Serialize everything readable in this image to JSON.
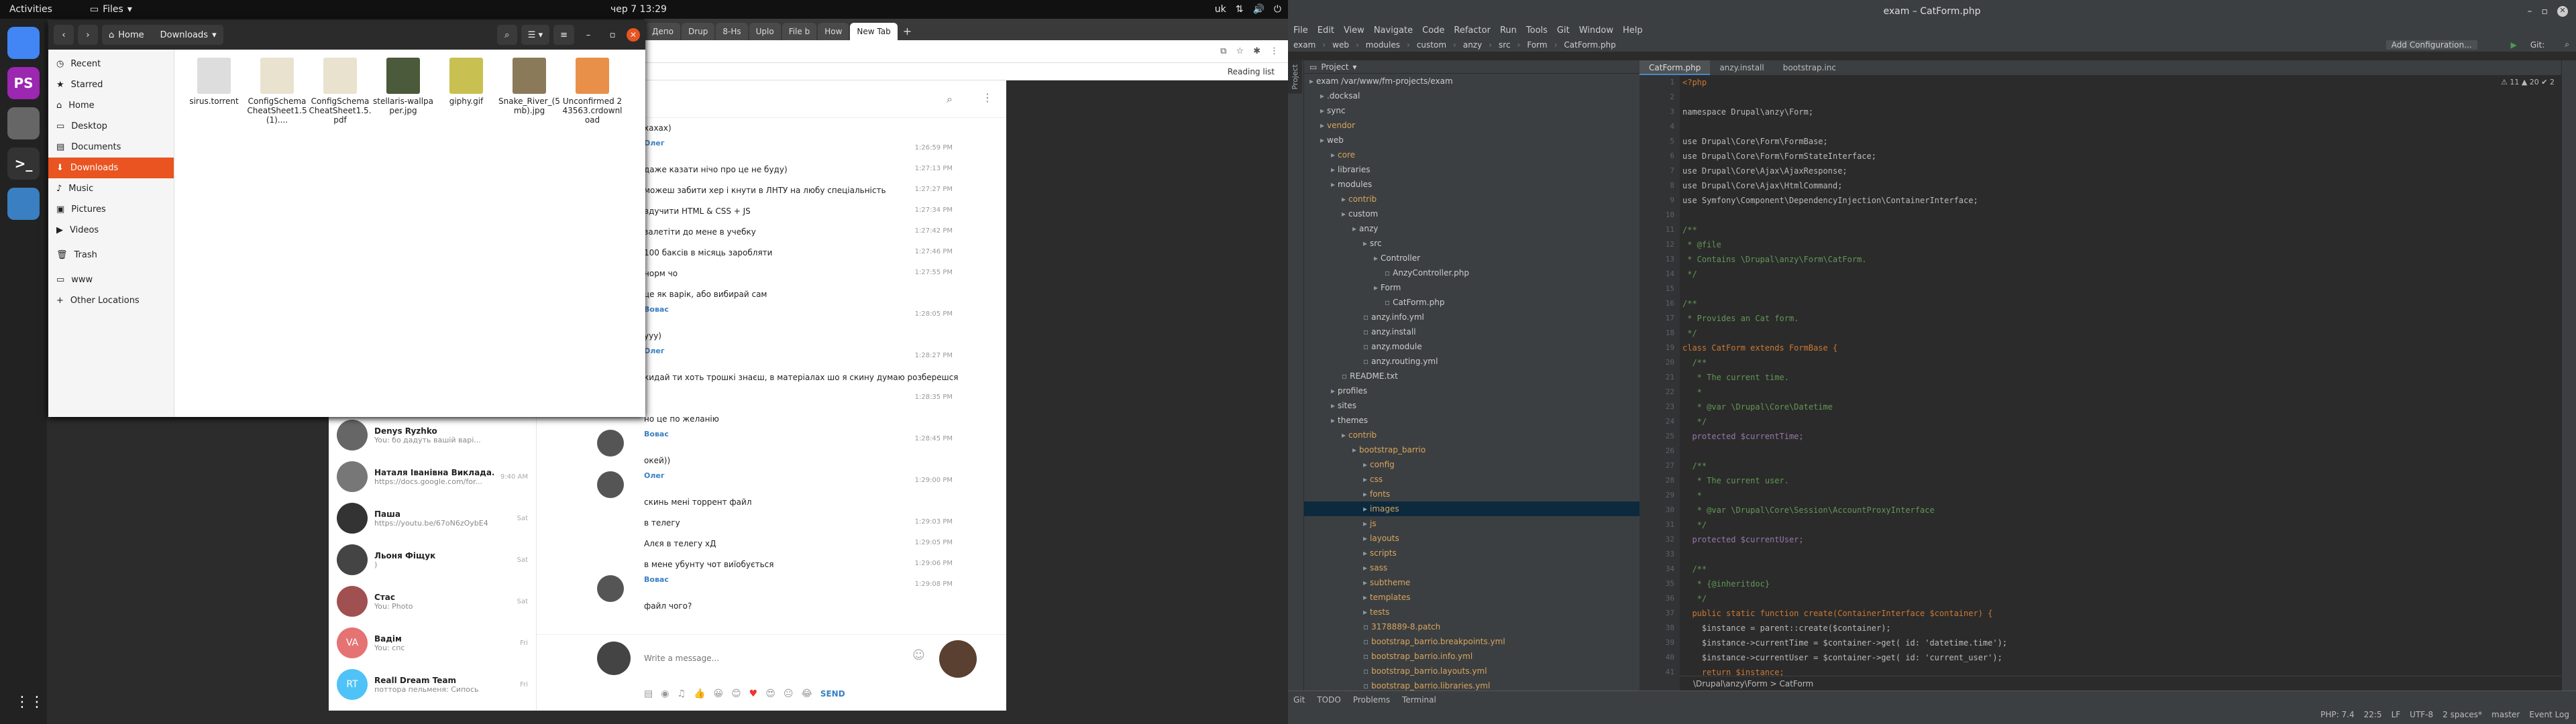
{
  "topbar": {
    "activities": "Activities",
    "app": "Files",
    "clock": "чер 7  13:29",
    "lang": "uk"
  },
  "dock": [
    {
      "name": "chrome-icon",
      "color": "#4285f4",
      "label": ""
    },
    {
      "name": "phpstorm-icon",
      "color": "#9c27b0",
      "label": "PS"
    },
    {
      "name": "files-icon",
      "color": "#666",
      "label": ""
    },
    {
      "name": "terminal-icon",
      "color": "#333",
      "label": ">_"
    },
    {
      "name": "screenshot-icon",
      "color": "#3a7fc1",
      "label": ""
    }
  ],
  "files": {
    "title": "Downloads",
    "home": "Home",
    "sidebar": [
      {
        "label": "Recent",
        "icon": "◷"
      },
      {
        "label": "Starred",
        "icon": "★"
      },
      {
        "label": "Home",
        "icon": "⌂"
      },
      {
        "label": "Desktop",
        "icon": "▭"
      },
      {
        "label": "Documents",
        "icon": "▤"
      },
      {
        "label": "Downloads",
        "icon": "⬇",
        "selected": true
      },
      {
        "label": "Music",
        "icon": "♪"
      },
      {
        "label": "Pictures",
        "icon": "▣"
      },
      {
        "label": "Videos",
        "icon": "▶"
      },
      {
        "label": "Trash",
        "icon": "🗑"
      },
      {
        "label": "www",
        "icon": "▭"
      },
      {
        "label": "Other Locations",
        "icon": "+"
      }
    ],
    "items": [
      {
        "label": "sirus.torrent",
        "color": "#ddd"
      },
      {
        "label": "ConfigSchemaCheatSheet1.5 (1)....",
        "color": "#e9e2cf"
      },
      {
        "label": "ConfigSchemaCheatSheet1.5.pdf",
        "color": "#e9e2cf"
      },
      {
        "label": "stellaris-wallpaper.jpg",
        "color": "#4a5a3a"
      },
      {
        "label": "giphy.gif",
        "color": "#c8c050"
      },
      {
        "label": "Snake_River_(5mb).jpg",
        "color": "#8a7a5a"
      },
      {
        "label": "Unconfirmed 243563.crdownload",
        "color": "#e8904a"
      }
    ]
  },
  "telegram": {
    "chats": [
      {
        "name": "Denys Ryzhko",
        "preview": "You: бо дадуть вашій варі...",
        "time": "",
        "color": "#666"
      },
      {
        "name": "Наталя Іванівна Виклада...",
        "preview": "https://docs.google.com/for...",
        "time": "9:40 AM",
        "color": "#777"
      },
      {
        "name": "Паша",
        "preview": "https://youtu.be/67oN6zOybE4",
        "time": "Sat",
        "color": "#333"
      },
      {
        "name": "Льоня Фіщук",
        "preview": ")",
        "time": "Sat",
        "color": "#444"
      },
      {
        "name": "Стас",
        "preview": "You: Photo",
        "time": "Sat",
        "color": "#a05050"
      },
      {
        "name": "Вадім",
        "preview": "You: спс",
        "time": "Fri",
        "color": "#e57373",
        "initials": "VA"
      },
      {
        "name": "Reall Dream Team",
        "preview": "поттора пельменя: Сипось",
        "time": "Fri",
        "color": "#4fc3f7",
        "initials": "RT"
      }
    ],
    "messages": [
      {
        "sender": "",
        "text": "хахах)",
        "time": ""
      },
      {
        "sender": "Олег",
        "text": "",
        "time": "1:26:59 PM"
      },
      {
        "sender": "",
        "text": "даже казати нічо про це не буду)",
        "time": "1:27:13 PM"
      },
      {
        "sender": "",
        "text": "можеш забити хер і кнути в ЛНТУ на любу спеціальність",
        "time": "1:27:27 PM"
      },
      {
        "sender": "",
        "text": "вдучити HTML & CSS + JS",
        "time": "1:27:34 PM"
      },
      {
        "sender": "",
        "text": "залетіти до мене в учебку",
        "time": "1:27:42 PM"
      },
      {
        "sender": "",
        "text": "100 баксів в місяць заробляти",
        "time": "1:27:46 PM"
      },
      {
        "sender": "",
        "text": "норм чо",
        "time": "1:27:55 PM"
      },
      {
        "sender": "",
        "text": "це як варік, або вибирай сам",
        "time": ""
      },
      {
        "sender": "Вовас",
        "text": "",
        "time": "1:28:05 PM"
      },
      {
        "sender": "",
        "text": "ууу)",
        "time": ""
      },
      {
        "sender": "Олег",
        "text": "",
        "time": "1:28:27 PM"
      },
      {
        "sender": "",
        "text": "кидай ти хоть трошкі знаєш, в матеріалах шо я скину думаю розберешся",
        "time": ""
      },
      {
        "sender": "",
        "text": "",
        "time": "1:28:35 PM"
      },
      {
        "sender": "",
        "text": "но це по желанію",
        "time": ""
      },
      {
        "sender": "Вовас",
        "text": "",
        "time": "1:28:45 PM"
      },
      {
        "sender": "",
        "text": "окей))",
        "time": ""
      },
      {
        "sender": "Олег",
        "text": "",
        "time": "1:29:00 PM"
      },
      {
        "sender": "",
        "text": "скинь мені торрент файл",
        "time": ""
      },
      {
        "sender": "",
        "text": "в телегу",
        "time": "1:29:03 PM"
      },
      {
        "sender": "",
        "text": "Алєя в телегу хД",
        "time": "1:29:05 PM"
      },
      {
        "sender": "",
        "text": "в мене убунту чот виїобується",
        "time": "1:29:06 PM"
      },
      {
        "sender": "Вовас",
        "text": "",
        "time": "1:29:08 PM"
      },
      {
        "sender": "",
        "text": "файл чого?",
        "time": ""
      }
    ],
    "input_placeholder": "Write a message...",
    "send": "SEND"
  },
  "chrome": {
    "tabs": [
      "Депо",
      "Drup",
      "8-Hs",
      "Uplo",
      "File b",
      "How",
      "New Tab"
    ],
    "reading_list": "Reading list"
  },
  "ide": {
    "title": "exam – CatForm.php",
    "menu": [
      "File",
      "Edit",
      "View",
      "Navigate",
      "Code",
      "Refactor",
      "Run",
      "Tools",
      "Git",
      "Window",
      "Help"
    ],
    "breadcrumb": [
      "exam",
      "web",
      "modules",
      "custom",
      "anzy",
      "src",
      "Form",
      "CatForm.php"
    ],
    "add_config": "Add Configuration...",
    "git": "Git:",
    "project_label": "Project",
    "tree": [
      {
        "d": 0,
        "t": "exam /var/www/fm-projects/exam",
        "c": "#ccc"
      },
      {
        "d": 1,
        "t": ".docksal",
        "c": "#ccc"
      },
      {
        "d": 1,
        "t": "sync",
        "c": "#ccc"
      },
      {
        "d": 1,
        "t": "vendor",
        "c": "#d8a55f"
      },
      {
        "d": 1,
        "t": "web",
        "c": "#ccc"
      },
      {
        "d": 2,
        "t": "core",
        "c": "#d8a55f"
      },
      {
        "d": 2,
        "t": "libraries",
        "c": "#ccc"
      },
      {
        "d": 2,
        "t": "modules",
        "c": "#ccc"
      },
      {
        "d": 3,
        "t": "contrib",
        "c": "#d8a55f"
      },
      {
        "d": 3,
        "t": "custom",
        "c": "#ccc"
      },
      {
        "d": 4,
        "t": "anzy",
        "c": "#ccc"
      },
      {
        "d": 5,
        "t": "src",
        "c": "#ccc"
      },
      {
        "d": 6,
        "t": "Controller",
        "c": "#ccc"
      },
      {
        "d": 7,
        "t": "AnzyController.php",
        "c": "#ccc"
      },
      {
        "d": 6,
        "t": "Form",
        "c": "#ccc"
      },
      {
        "d": 7,
        "t": "CatForm.php",
        "c": "#ccc"
      },
      {
        "d": 5,
        "t": "anzy.info.yml",
        "c": "#ccc"
      },
      {
        "d": 5,
        "t": "anzy.install",
        "c": "#ccc"
      },
      {
        "d": 5,
        "t": "anzy.module",
        "c": "#ccc"
      },
      {
        "d": 5,
        "t": "anzy.routing.yml",
        "c": "#ccc"
      },
      {
        "d": 3,
        "t": "README.txt",
        "c": "#ccc"
      },
      {
        "d": 2,
        "t": "profiles",
        "c": "#ccc"
      },
      {
        "d": 2,
        "t": "sites",
        "c": "#ccc"
      },
      {
        "d": 2,
        "t": "themes",
        "c": "#ccc"
      },
      {
        "d": 3,
        "t": "contrib",
        "c": "#d8a55f"
      },
      {
        "d": 4,
        "t": "bootstrap_barrio",
        "c": "#d8a55f"
      },
      {
        "d": 5,
        "t": "config",
        "c": "#d8a55f"
      },
      {
        "d": 5,
        "t": "css",
        "c": "#d8a55f"
      },
      {
        "d": 5,
        "t": "fonts",
        "c": "#d8a55f"
      },
      {
        "d": 5,
        "t": "images",
        "c": "#d8a55f",
        "sel": true
      },
      {
        "d": 5,
        "t": "js",
        "c": "#d8a55f"
      },
      {
        "d": 5,
        "t": "layouts",
        "c": "#d8a55f"
      },
      {
        "d": 5,
        "t": "scripts",
        "c": "#d8a55f"
      },
      {
        "d": 5,
        "t": "sass",
        "c": "#d8a55f"
      },
      {
        "d": 5,
        "t": "subtheme",
        "c": "#d8a55f"
      },
      {
        "d": 5,
        "t": "templates",
        "c": "#d8a55f"
      },
      {
        "d": 5,
        "t": "tests",
        "c": "#d8a55f"
      },
      {
        "d": 5,
        "t": "3178889-8.patch",
        "c": "#d8a55f"
      },
      {
        "d": 5,
        "t": "bootstrap_barrio.breakpoints.yml",
        "c": "#d8a55f"
      },
      {
        "d": 5,
        "t": "bootstrap_barrio.info.yml",
        "c": "#d8a55f"
      },
      {
        "d": 5,
        "t": "bootstrap_barrio.layouts.yml",
        "c": "#d8a55f"
      },
      {
        "d": 5,
        "t": "bootstrap_barrio.libraries.yml",
        "c": "#d8a55f"
      }
    ],
    "tabs": [
      {
        "t": "CatForm.php",
        "on": true
      },
      {
        "t": "anzy.install",
        "on": false
      },
      {
        "t": "bootstrap.inc",
        "on": false
      }
    ],
    "code": [
      {
        "t": "<?php",
        "c": "#cc7832"
      },
      {
        "t": "",
        "c": "#bbb"
      },
      {
        "t": "namespace Drupal\\anzy\\Form;",
        "c": "#bbb"
      },
      {
        "t": "",
        "c": "#bbb"
      },
      {
        "t": "use Drupal\\Core\\Form\\FormBase;",
        "c": "#bbb"
      },
      {
        "t": "use Drupal\\Core\\Form\\FormStateInterface;",
        "c": "#bbb"
      },
      {
        "t": "use Drupal\\Core\\Ajax\\AjaxResponse;",
        "c": "#bbb"
      },
      {
        "t": "use Drupal\\Core\\Ajax\\HtmlCommand;",
        "c": "#bbb"
      },
      {
        "t": "use Symfony\\Component\\DependencyInjection\\ContainerInterface;",
        "c": "#bbb"
      },
      {
        "t": "",
        "c": "#bbb"
      },
      {
        "t": "/**",
        "c": "#629755"
      },
      {
        "t": " * @file",
        "c": "#629755"
      },
      {
        "t": " * Contains \\Drupal\\anzy\\Form\\CatForm.",
        "c": "#629755"
      },
      {
        "t": " */",
        "c": "#629755"
      },
      {
        "t": "",
        "c": "#bbb"
      },
      {
        "t": "/**",
        "c": "#629755"
      },
      {
        "t": " * Provides an Cat form.",
        "c": "#629755"
      },
      {
        "t": " */",
        "c": "#629755"
      },
      {
        "t": "class CatForm extends FormBase {",
        "c": "#cc7832"
      },
      {
        "t": "  /**",
        "c": "#629755"
      },
      {
        "t": "   * The current time.",
        "c": "#629755"
      },
      {
        "t": "   *",
        "c": "#629755"
      },
      {
        "t": "   * @var \\Drupal\\Core\\Datetime",
        "c": "#629755"
      },
      {
        "t": "   */",
        "c": "#629755"
      },
      {
        "t": "  protected $currentTime;",
        "c": "#9876aa"
      },
      {
        "t": "",
        "c": "#bbb"
      },
      {
        "t": "  /**",
        "c": "#629755"
      },
      {
        "t": "   * The current user.",
        "c": "#629755"
      },
      {
        "t": "   *",
        "c": "#629755"
      },
      {
        "t": "   * @var \\Drupal\\Core\\Session\\AccountProxyInterface",
        "c": "#629755"
      },
      {
        "t": "   */",
        "c": "#629755"
      },
      {
        "t": "  protected $currentUser;",
        "c": "#9876aa"
      },
      {
        "t": "",
        "c": "#bbb"
      },
      {
        "t": "  /**",
        "c": "#629755"
      },
      {
        "t": "   * {@inheritdoc}",
        "c": "#629755"
      },
      {
        "t": "   */",
        "c": "#629755"
      },
      {
        "t": "  public static function create(ContainerInterface $container) {",
        "c": "#cc7832"
      },
      {
        "t": "    $instance = parent::create($container);",
        "c": "#bbb"
      },
      {
        "t": "    $instance->currentTime = $container->get( id: 'datetime.time');",
        "c": "#bbb"
      },
      {
        "t": "    $instance->currentUser = $container->get( id: 'current_user');",
        "c": "#bbb"
      },
      {
        "t": "    return $instance;",
        "c": "#cc7832"
      }
    ],
    "crumb_bottom": "\\Drupal\\anzy\\Form  >  CatForm",
    "warnings": "⚠ 11  ▲ 20  ✔ 2",
    "bottom_tabs": [
      "Git",
      "TODO",
      "Problems",
      "Terminal"
    ],
    "status": [
      "PHP: 7.4",
      "22:5",
      "LF",
      "UTF-8",
      "2 spaces*",
      "master"
    ],
    "event_log": "Event Log"
  }
}
